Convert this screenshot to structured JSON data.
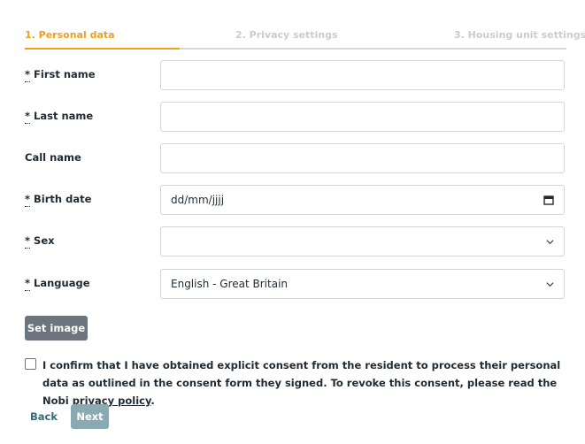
{
  "steps": {
    "personal": "1. Personal data",
    "privacy": "2. Privacy settings",
    "housing": "3. Housing unit settings"
  },
  "form": {
    "required_marker": "*",
    "first_name_label": "First name",
    "first_name_value": "",
    "last_name_label": "Last name",
    "last_name_value": "",
    "call_name_label": "Call name",
    "call_name_value": "",
    "birth_date_label": "Birth date",
    "birth_date_value": "dd/mm/jjjj",
    "sex_label": "Sex",
    "sex_value": "",
    "language_label": "Language",
    "language_value": "English - Great Britain"
  },
  "set_image_label": "Set image",
  "consent": {
    "text": "I confirm that I have obtained explicit consent from the resident to process their personal data as outlined in the consent form they signed. To revoke this consent, please read the Nobi ",
    "link": "privacy policy",
    "end": ".",
    "checked": false
  },
  "buttons": {
    "back": "Back",
    "next": "Next"
  },
  "icons": {
    "calendar": "calendar-icon",
    "dropdown": "chevron-down-icon",
    "checkbox": "checkbox-icon"
  },
  "colors": {
    "active_step": "#f0a01e",
    "primary_button": "#6c757d",
    "next_button": "#8aaab1",
    "link": "#2f6b7c"
  }
}
